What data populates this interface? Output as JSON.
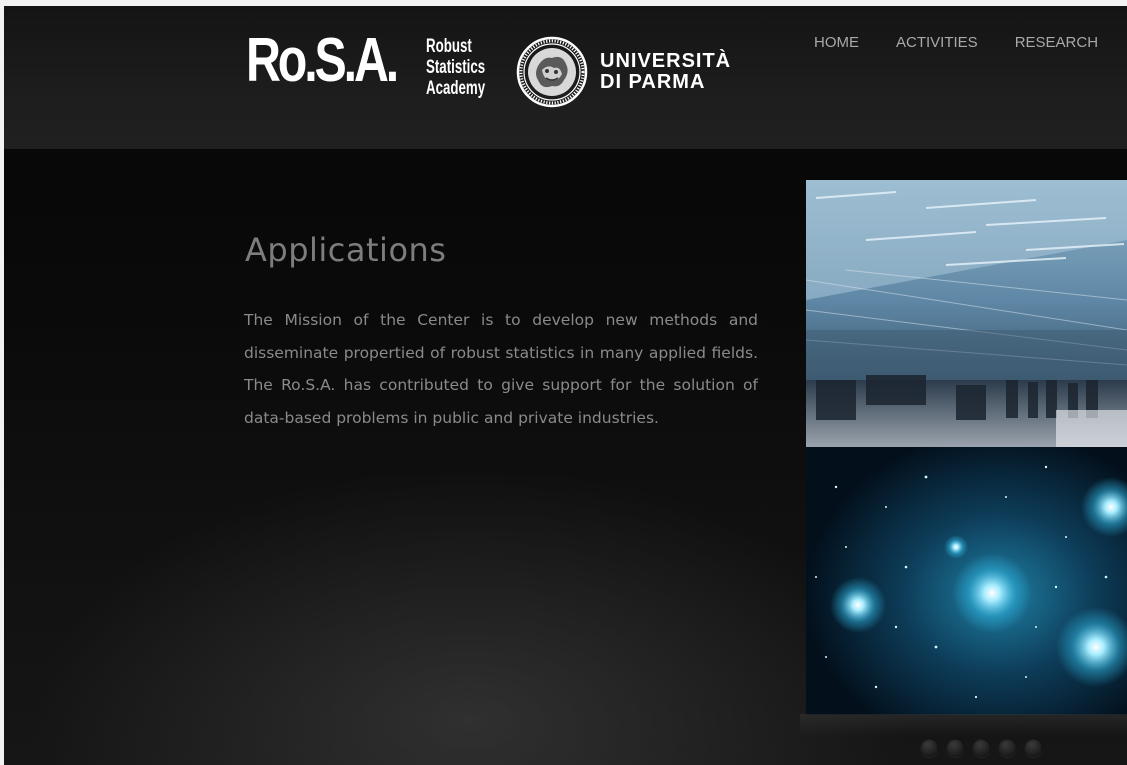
{
  "header": {
    "logo": {
      "main": "Ro.S.A.",
      "sub_lines": [
        "Robust",
        "Statistics",
        "Academy"
      ]
    },
    "university": {
      "lines": [
        "UNIVERSITÀ",
        "DI PARMA"
      ],
      "seal_icon": "university-seal-icon"
    },
    "nav": {
      "items": [
        {
          "label": "HOME"
        },
        {
          "label": "ACTIVITIES"
        },
        {
          "label": "RESEARCH"
        }
      ]
    }
  },
  "main": {
    "title": "Applications",
    "body": "The Mission of the Center is to develop new methods and disseminate propertied of robust statistics in many applied fields. The Ro.S.A. has contributed to give support for the solution of data-based problems in public and private industries."
  },
  "slider": {
    "dot_count": 5
  },
  "colors": {
    "background": "#0b0b0b",
    "header": "#1d1d1d",
    "heading_text": "#7d7d7d",
    "body_text": "#8a8a8a",
    "nav_text": "#a9a9a9"
  }
}
